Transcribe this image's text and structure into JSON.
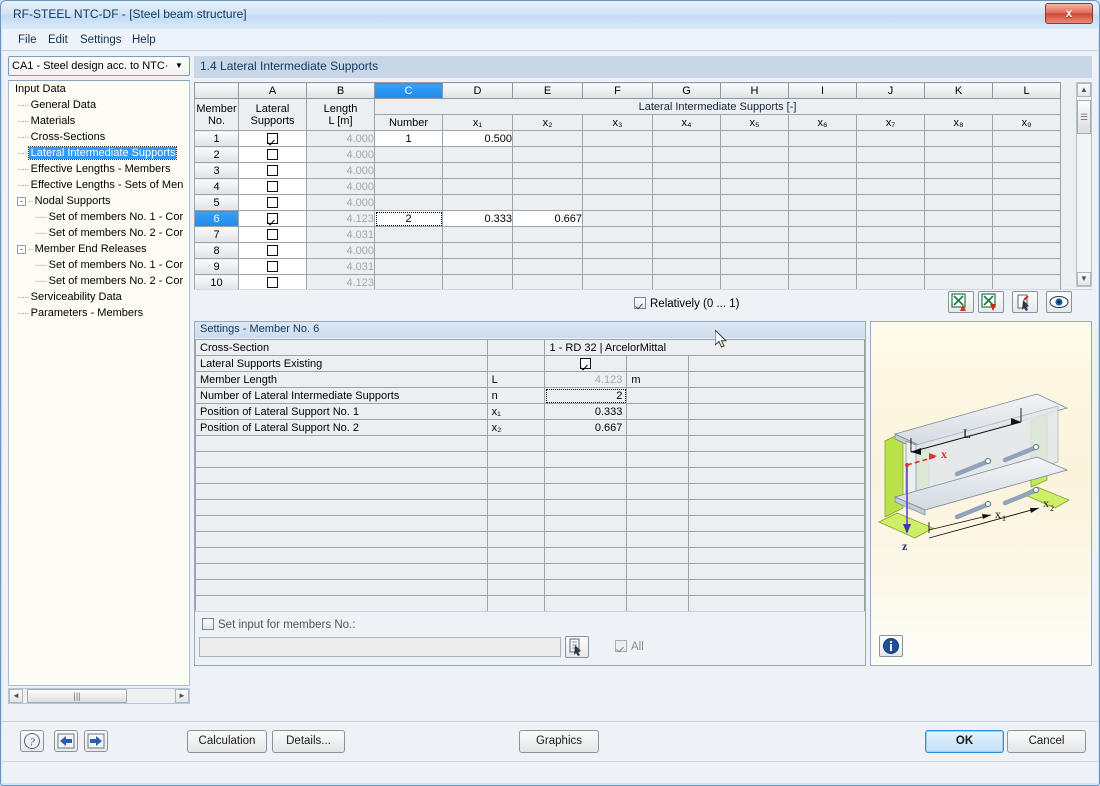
{
  "window": {
    "title": "RF-STEEL NTC-DF - [Steel beam structure]",
    "close_label": "x"
  },
  "menubar": {
    "items": [
      "File",
      "Edit",
      "Settings",
      "Help"
    ]
  },
  "nav": {
    "combo_value": "CA1 - Steel design acc. to NTC·",
    "combo_arrow": "▼",
    "tree": [
      {
        "label": "Input Data",
        "depth": 0,
        "kind": "root"
      },
      {
        "label": "General Data",
        "depth": 1,
        "kind": "leaf"
      },
      {
        "label": "Materials",
        "depth": 1,
        "kind": "leaf"
      },
      {
        "label": "Cross-Sections",
        "depth": 1,
        "kind": "leaf"
      },
      {
        "label": "Lateral Intermediate Supports",
        "depth": 1,
        "kind": "leaf",
        "selected": true
      },
      {
        "label": "Effective Lengths - Members",
        "depth": 1,
        "kind": "leaf"
      },
      {
        "label": "Effective Lengths - Sets of Men",
        "depth": 1,
        "kind": "leaf"
      },
      {
        "label": "Nodal Supports",
        "depth": 1,
        "kind": "group",
        "expander": "-"
      },
      {
        "label": "Set of members No. 1 - Cor",
        "depth": 2,
        "kind": "leaf"
      },
      {
        "label": "Set of members No. 2 - Cor",
        "depth": 2,
        "kind": "leaf"
      },
      {
        "label": "Member End Releases",
        "depth": 1,
        "kind": "group",
        "expander": "-"
      },
      {
        "label": "Set of members No. 1 - Cor",
        "depth": 2,
        "kind": "leaf"
      },
      {
        "label": "Set of members No. 2 - Cor",
        "depth": 2,
        "kind": "leaf"
      },
      {
        "label": "Serviceability Data",
        "depth": 1,
        "kind": "leaf"
      },
      {
        "label": "Parameters - Members",
        "depth": 1,
        "kind": "leaf"
      }
    ],
    "hscroll": {
      "left": "◄",
      "right": "►",
      "grip": "|||"
    }
  },
  "content": {
    "title": "1.4 Lateral Intermediate Supports"
  },
  "table": {
    "column_letters": [
      "A",
      "B",
      "C",
      "D",
      "E",
      "F",
      "G",
      "H",
      "I",
      "J",
      "K",
      "L"
    ],
    "selected_column": "C",
    "group_header": "Lateral Intermediate Supports [-]",
    "row_header_line1": "Member",
    "row_header_line2": "No.",
    "sub_headers": {
      "a_line1": "Lateral",
      "a_line2": "Supports",
      "b_line1": "Length",
      "b_line2": "L [m]",
      "c": "Number",
      "x": [
        "x₁",
        "x₂",
        "x₃",
        "x₄",
        "x₅",
        "x₆",
        "x₇",
        "x₈",
        "x₉"
      ]
    },
    "rows": [
      {
        "no": "1",
        "checked": true,
        "length": "4.000",
        "number": "1",
        "x1": "0.500",
        "x2": ""
      },
      {
        "no": "2",
        "checked": false,
        "length": "4.000",
        "number": "",
        "x1": "",
        "x2": ""
      },
      {
        "no": "3",
        "checked": false,
        "length": "4.000",
        "number": "",
        "x1": "",
        "x2": ""
      },
      {
        "no": "4",
        "checked": false,
        "length": "4.000",
        "number": "",
        "x1": "",
        "x2": ""
      },
      {
        "no": "5",
        "checked": false,
        "length": "4.000",
        "number": "",
        "x1": "",
        "x2": ""
      },
      {
        "no": "6",
        "checked": true,
        "length": "4.123",
        "number": "2",
        "x1": "0.333",
        "x2": "0.667",
        "selected": true
      },
      {
        "no": "7",
        "checked": false,
        "length": "4.031",
        "number": "",
        "x1": "",
        "x2": ""
      },
      {
        "no": "8",
        "checked": false,
        "length": "4.000",
        "number": "",
        "x1": "",
        "x2": ""
      },
      {
        "no": "9",
        "checked": false,
        "length": "4.031",
        "number": "",
        "x1": "",
        "x2": ""
      },
      {
        "no": "10",
        "checked": false,
        "length": "4.123",
        "number": "",
        "x1": "",
        "x2": ""
      }
    ],
    "vscroll": {
      "up": "▲",
      "down": "▼",
      "grip": "☰"
    }
  },
  "relatively": {
    "label": "Relatively (0 ... 1)",
    "checked": true
  },
  "table_toolbar": [
    {
      "name": "import-excel-up-button",
      "title": "Import from Excel"
    },
    {
      "name": "export-excel-down-button",
      "title": "Export to Excel"
    },
    {
      "name": "pick-from-model-button",
      "title": "Select in model"
    },
    {
      "name": "view-mode-button",
      "title": "View mode"
    }
  ],
  "settings": {
    "title": "Settings - Member No. 6",
    "rows": [
      {
        "label": "Cross-Section",
        "symbol": "",
        "value": "1 - RD 32 | ArcelorMittal",
        "unit": "",
        "type": "crosssection"
      },
      {
        "label": "Lateral Supports Existing",
        "symbol": "",
        "value": "",
        "unit": "",
        "type": "checkbox",
        "checked": true
      },
      {
        "label": "Member Length",
        "symbol": "L",
        "value": "4.123",
        "unit": "m",
        "type": "readonly"
      },
      {
        "label": "Number of Lateral Intermediate Supports",
        "symbol": "n",
        "value": "2",
        "unit": "",
        "type": "editable",
        "focused": true
      },
      {
        "label": "Position of Lateral Support No. 1",
        "symbol": "x₁",
        "value": "0.333",
        "unit": "",
        "type": "editable"
      },
      {
        "label": "Position of Lateral Support No. 2",
        "symbol": "x₂",
        "value": "0.667",
        "unit": "",
        "type": "editable"
      }
    ],
    "empty_row_count": 13,
    "set_input_label": "Set input for members No.:",
    "set_input_checked": false,
    "members_value": "",
    "all_label": "All",
    "all_checked": true
  },
  "graphic": {
    "labels": {
      "L": "L",
      "x": "x",
      "z": "z",
      "x1": "x₁",
      "x2": "x₂"
    },
    "info_title": "Info"
  },
  "bottombar": {
    "help_title": "Help",
    "prev_title": "Previous",
    "next_title": "Next",
    "calculation": "Calculation",
    "details": "Details...",
    "graphics": "Graphics",
    "ok": "OK",
    "cancel": "Cancel"
  }
}
